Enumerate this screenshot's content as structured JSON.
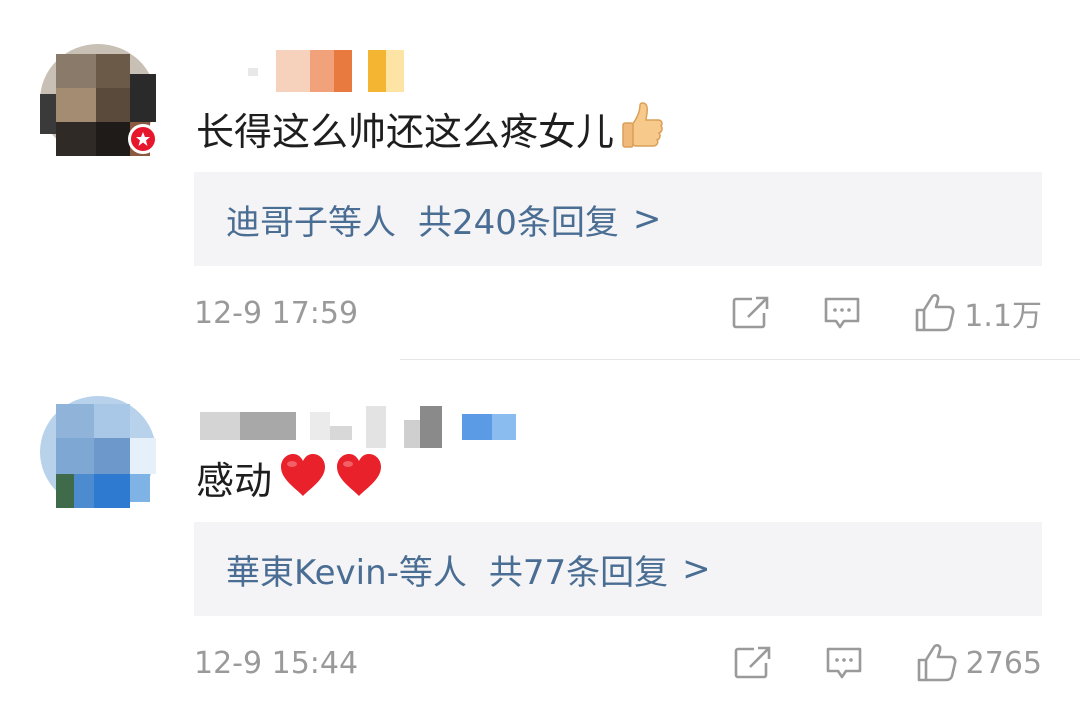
{
  "comments": [
    {
      "text": "长得这么帅还这么疼女儿",
      "replies_who": "迪哥子等人",
      "replies_count": "共240条回复",
      "replies_arrow": ">",
      "time": "12-9 17:59",
      "likes": "1.1万"
    },
    {
      "text": "感动",
      "replies_who": "華東Kevin-等人",
      "replies_count": "共77条回复",
      "replies_arrow": ">",
      "time": "12-9 15:44",
      "likes": "2765"
    }
  ],
  "icons": {
    "share": "share-icon",
    "comment": "comment-icon",
    "like": "thumbs-up-icon",
    "verified": "verified-badge-icon",
    "emoji_thumbs": "thumbs-up-emoji",
    "emoji_heart": "red-heart-emoji"
  },
  "colors": {
    "link": "#4a6d93",
    "meta": "#9a9a9a",
    "reply_bg": "#f4f4f6",
    "badge": "#e6162d",
    "heart": "#e8212b"
  }
}
